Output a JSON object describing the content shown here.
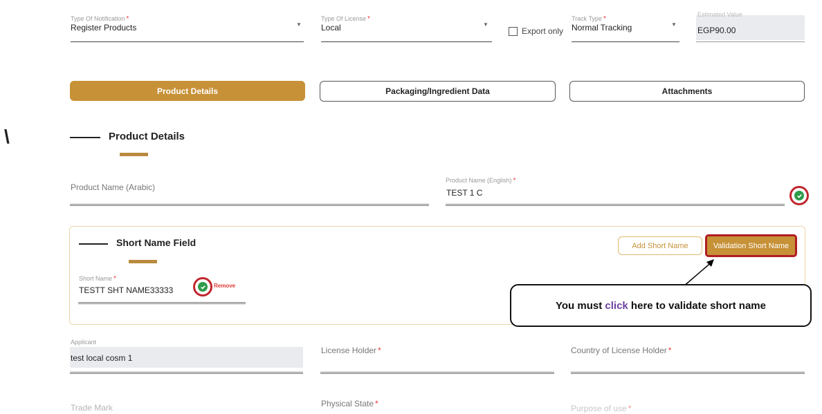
{
  "header_row": {
    "notification": {
      "label": "Type Of Notification",
      "value": "Register Products"
    },
    "license": {
      "label": "Type Of License",
      "value": "Local"
    },
    "export_only": "Export only",
    "track": {
      "label": "Track Type",
      "value": "Normal Tracking"
    },
    "estimated": {
      "label": "Estimated Value",
      "value": "EGP90.00"
    }
  },
  "tabs": [
    {
      "label": "Product Details"
    },
    {
      "label": "Packaging/Ingredient Data"
    },
    {
      "label": "Attachments"
    }
  ],
  "section_title": "Product Details",
  "left_glyph": "\\",
  "product_name_arabic": {
    "label": "Product Name (Arabic)"
  },
  "product_name_english": {
    "label": "Product Name (English)",
    "value": "TEST 1 C"
  },
  "short_name_section": {
    "title": "Short Name Field",
    "field_label": "Short Name",
    "value": "TESTT SHT NAME33333",
    "remove_label": "Remove",
    "add_button": "Add Short Name",
    "validate_button": "Validation Short Name"
  },
  "callout": {
    "before": "You must ",
    "highlight": "click",
    "after": " here to validate short name"
  },
  "applicant": {
    "label": "Applicant",
    "value": "test local cosm 1"
  },
  "license_holder": {
    "label": "License Holder"
  },
  "country_license_holder": {
    "label": "Country of License Holder"
  },
  "trade_mark": {
    "label": "Trade Mark"
  },
  "physical_state": {
    "label": "Physical State"
  },
  "purpose_of_use": {
    "label": "Purpose of use"
  },
  "required_mark": "*",
  "colors": {
    "gold": "#c79137",
    "highlight_red": "#c0262d",
    "check_green": "#2e9c4a"
  }
}
